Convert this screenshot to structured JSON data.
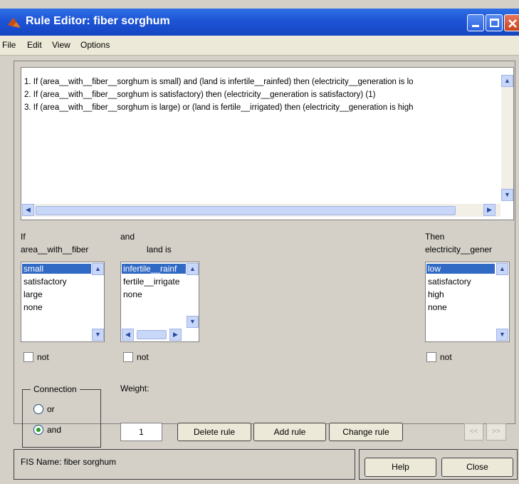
{
  "window": {
    "title": "Rule Editor: fiber  sorghum"
  },
  "menu": [
    "File",
    "Edit",
    "View",
    "Options"
  ],
  "rules": [
    "1. If (area__with__fiber__sorghum is small) and (land is infertile__rainfed) then (electricity__generation is lo",
    "2. If (area__with__fiber__sorghum is satisfactory) then (electricity__generation is satisfactory) (1)",
    "3. If (area__with__fiber__sorghum is large) or (land is fertile__irrigated) then (electricity__generation is high"
  ],
  "input1": {
    "keyword": "If",
    "name": "area__with__fiber",
    "options": [
      "small",
      "satisfactory",
      "large",
      "none"
    ],
    "selected": "small",
    "not_label": "not"
  },
  "input2": {
    "keyword": "and",
    "name": "land is",
    "options": [
      "infertile__rainf",
      "fertile__irrigate",
      "none"
    ],
    "selected": "infertile__rainf",
    "not_label": "not"
  },
  "output": {
    "keyword": "Then",
    "name": "electricity__gener",
    "options": [
      "low",
      "satisfactory",
      "high",
      "none"
    ],
    "selected": "low",
    "not_label": "not"
  },
  "connection": {
    "label": "Connection",
    "options": [
      "or",
      "and"
    ],
    "selected": "and"
  },
  "weight": {
    "label": "Weight:",
    "value": "1"
  },
  "buttons": {
    "delete": "Delete rule",
    "add": "Add rule",
    "change": "Change rule",
    "prev": "<<",
    "next": ">>",
    "help": "Help",
    "close": "Close"
  },
  "status": {
    "text": "FIS Name: fiber  sorghum"
  }
}
